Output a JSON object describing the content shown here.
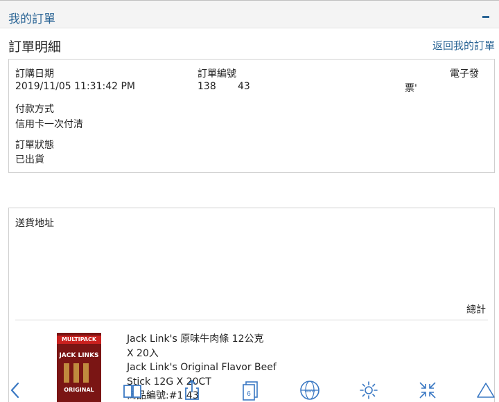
{
  "header": {
    "title": "我的訂單"
  },
  "section": {
    "title": "訂單明細",
    "back_link": "返回我的訂單"
  },
  "order": {
    "date_label": "訂購日期",
    "date_value": "2019/11/05 11:31:42 PM",
    "number_label": "訂單編號",
    "number_value_a": "138",
    "number_value_b": "43",
    "invoice_label": "電子發",
    "invoice_value": "票'",
    "payment_label": "付款方式",
    "payment_value": "信用卡一次付清",
    "status_label": "訂單狀態",
    "status_value": "已出貨"
  },
  "shipping": {
    "address_label": "送貨地址",
    "total_label": "總計"
  },
  "product": {
    "name_line1": "Jack Link's 原味牛肉條 12公克",
    "name_line2": "X 20入",
    "name_line3": "Jack Link's Original Flavor Beef",
    "name_line4": "Stick 12G X 20CT",
    "item_no": "商品編號:#1    43",
    "image_text": {
      "band": "MULTIPACK",
      "brand": "JACK LINKS",
      "flavor": "ORIGINAL"
    }
  },
  "toolbar": {
    "icons": [
      "back-icon",
      "book-icon",
      "share-icon",
      "tabs-icon",
      "globe-icon",
      "brightness-icon",
      "collapse-arrows-icon",
      "triangle-up-icon"
    ],
    "tabs_count": "6",
    "globe_text": "www",
    "accent_color": "#3a78c3"
  },
  "colors": {
    "link": "#2b6595",
    "header_bg": "#f4f4f4",
    "border": "#cfcfcf"
  }
}
